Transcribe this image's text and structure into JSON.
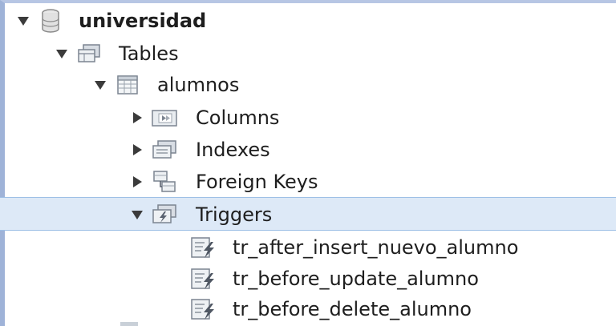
{
  "tree": {
    "database": {
      "label": "universidad",
      "expanded": true,
      "icon": "database-icon"
    },
    "tables_group": {
      "label": "Tables",
      "expanded": true,
      "icon": "tables-folder-icon"
    },
    "table": {
      "label": "alumnos",
      "expanded": true,
      "icon": "table-icon"
    },
    "children": [
      {
        "label": "Columns",
        "expanded": false,
        "icon": "columns-folder-icon"
      },
      {
        "label": "Indexes",
        "expanded": false,
        "icon": "indexes-folder-icon"
      },
      {
        "label": "Foreign Keys",
        "expanded": false,
        "icon": "foreign-keys-folder-icon"
      },
      {
        "label": "Triggers",
        "expanded": true,
        "selected": true,
        "icon": "triggers-folder-icon"
      }
    ],
    "triggers": [
      {
        "label": "tr_after_insert_nuevo_alumno",
        "icon": "trigger-icon"
      },
      {
        "label": "tr_before_update_alumno",
        "icon": "trigger-icon"
      },
      {
        "label": "tr_before_delete_alumno",
        "icon": "trigger-icon"
      }
    ]
  },
  "colors": {
    "selection_background": "#dde9f7",
    "selection_border": "#9ec0e6",
    "window_border": "#9fb3d8"
  }
}
